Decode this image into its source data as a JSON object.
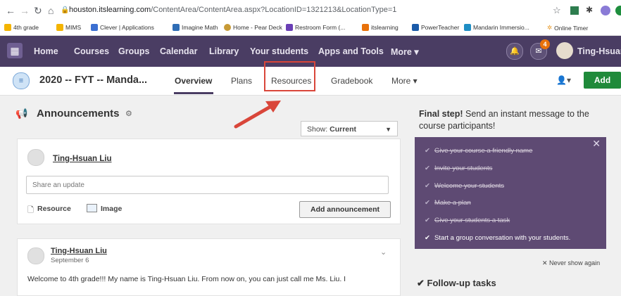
{
  "browser": {
    "url_host": "houston.itslearning.com",
    "url_path": "/ContentArea/ContentArea.aspx?LocationID=1321213&LocationType=1",
    "bookmarks": [
      "4th grade",
      "MIMS",
      "Clever | Applications",
      "Imagine Math",
      "Home - Pear Deck",
      "Restroom Form  (...",
      "itslearning",
      "PowerTeacher",
      "Mandarin Immersio...",
      "Online Timer"
    ],
    "colors": {
      "folder": "#f4b400",
      "clever": "#3b6fd1",
      "imagine": "#2f6db5",
      "pear": "#c79a36",
      "restroom": "#6a3fb5",
      "its": "#e8710a",
      "power": "#1a5aa8",
      "mandarin": "#1f8ec4"
    }
  },
  "topnav": {
    "items": [
      "Home",
      "Courses",
      "Groups",
      "Calendar",
      "Library",
      "Your students",
      "Apps and Tools",
      "More"
    ],
    "notification_count": "4",
    "user_name": "Ting-Hsuan"
  },
  "course": {
    "title": "2020 -- FYT -- Manda...",
    "tabs": [
      "Overview",
      "Plans",
      "Resources",
      "Gradebook",
      "More"
    ],
    "add_label": "Add"
  },
  "announcements": {
    "heading": "Announcements",
    "show_label": "Show:",
    "show_value": "Current",
    "composer_name": "Ting-Hsuan Liu",
    "composer_placeholder": "Share an update",
    "resource_label": "Resource",
    "image_label": "Image",
    "add_button": "Add announcement",
    "post": {
      "author": "Ting-Hsuan Liu",
      "date": "September 6",
      "body": "Welcome to 4th grade!!! My name is Ting-Hsuan Liu. From now on, you can just call me Ms. Liu. I"
    }
  },
  "final_step": {
    "bold": "Final step!",
    "text": " Send an instant message to the course participants!",
    "tasks_done": [
      "Give your course a friendly name",
      "Invite your students",
      "Welcome your students",
      "Make a plan",
      "Give your students a task"
    ],
    "task_open": "Start a group conversation with your students.",
    "never_show": "Never show again",
    "followup": "Follow-up tasks"
  },
  "colors": {
    "nav": "#4a3d63",
    "panel": "#5e4a73",
    "add_green": "#1f8a3a",
    "highlight_red": "#d9463a"
  }
}
